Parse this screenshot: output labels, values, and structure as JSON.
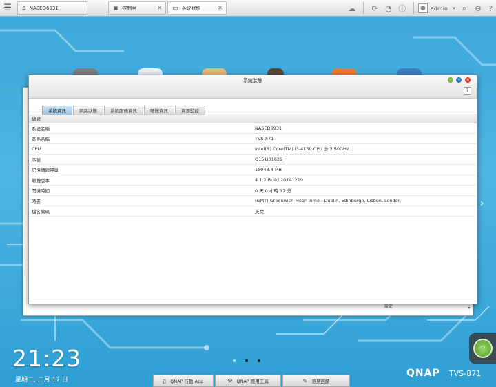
{
  "taskbar": {
    "home_tab": "NASED6931",
    "control_panel_tab": "控制台",
    "system_status_tab": "系統狀態",
    "user": "admin",
    "icons": [
      "menu-icon",
      "home-icon",
      "control-panel-icon",
      "monitor-icon",
      "cloud-icon",
      "refresh-icon",
      "clock-icon",
      "info-icon",
      "user-icon",
      "search-icon",
      "gear-icon",
      "help-icon"
    ]
  },
  "window": {
    "title": "系統狀態",
    "help_label": "?",
    "tabs": [
      {
        "label": "系統資訊",
        "active": true
      },
      {
        "label": "網路狀態",
        "active": false
      },
      {
        "label": "系統服務資訊",
        "active": false
      },
      {
        "label": "硬體資訊",
        "active": false
      },
      {
        "label": "資源監控",
        "active": false
      }
    ],
    "section": "總覽",
    "rows": [
      {
        "key": "系統名稱",
        "value": "NASED6931"
      },
      {
        "key": "產品名稱",
        "value": "TVS-871"
      },
      {
        "key": "CPU",
        "value": "Intel(R) Core(TM) i3-4150 CPU @ 3.50GHz"
      },
      {
        "key": "序號",
        "value": "Q151I01825"
      },
      {
        "key": "記憶體總容量",
        "value": "15948.4 MB"
      },
      {
        "key": "韌體版本",
        "value": "4.1.2 Build 20141219"
      },
      {
        "key": "開機時間",
        "value": "0 天 0 小時 17 分"
      },
      {
        "key": "時區",
        "value": "(GMT) Greenwich Mean Time : Dublin, Edinburgh, Lisbon, London"
      },
      {
        "key": "檔名編碼",
        "value": "英文"
      }
    ]
  },
  "background_window": {
    "label": "設定"
  },
  "desktop": {
    "clock": "21:23",
    "date": "星期二, 二月 17 日",
    "pages": 3,
    "active_page": 2,
    "dock": [
      {
        "label": "QNAP 行動 App",
        "icon": "phone-icon"
      },
      {
        "label": "QNAP 應用工具",
        "icon": "tools-icon"
      },
      {
        "label": "意見回饋",
        "icon": "feedback-icon"
      }
    ],
    "brand": "QNAP",
    "model": "TVS-871"
  },
  "colors": {
    "desktop": "#3aa6d8",
    "active_tab": "#9cc4e4",
    "close": "#e03b2c",
    "minimize": "#77b83a",
    "maximize": "#2a7fd0"
  }
}
